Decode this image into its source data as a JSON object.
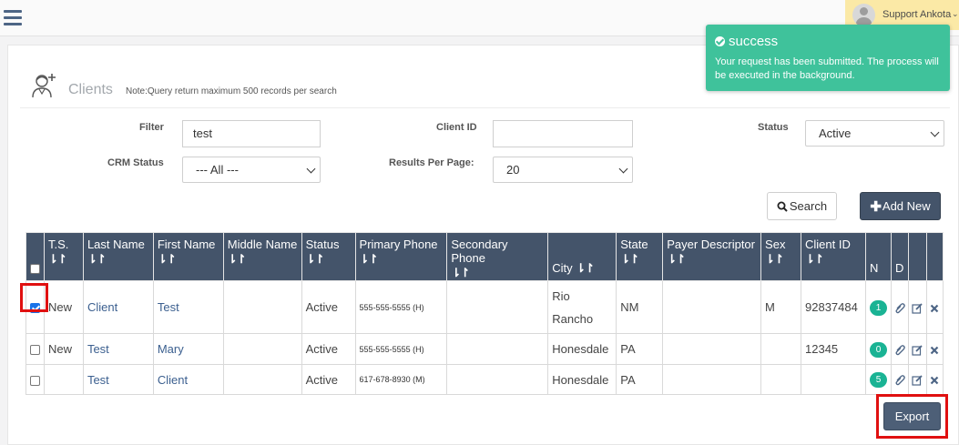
{
  "topbar": {
    "user_name": "Support Ankota",
    "caret": "⌄"
  },
  "page": {
    "title": "Clients",
    "note": "Note:Query return maximum 500 records per search"
  },
  "filters": {
    "filter_label": "Filter",
    "filter_value": "test",
    "client_id_label": "Client ID",
    "client_id_value": "",
    "status_label": "Status",
    "status_value": "Active",
    "crm_status_label": "CRM Status",
    "crm_status_value": "--- All ---",
    "results_per_page_label": "Results Per Page:",
    "results_per_page_value": "20"
  },
  "buttons": {
    "search": "Search",
    "add_new": "Add New",
    "export": "Export"
  },
  "table": {
    "headers": [
      "T.S.",
      "Last Name",
      "First Name",
      "Middle Name",
      "Status",
      "Primary Phone",
      "Secondary Phone",
      "City",
      "State",
      "Payer Descriptor",
      "Sex",
      "Client ID",
      "N",
      "D"
    ],
    "sort_glyph": "⇂↾",
    "rows": [
      {
        "checked": true,
        "ts": "New",
        "last": "Client",
        "first": "Test",
        "middle": "",
        "status": "Active",
        "primary_phone": "555-555-5555 (H)",
        "secondary_phone": "",
        "city_line1": "Rio",
        "city_line2": "Rancho",
        "state": "NM",
        "payer": "",
        "sex": "M",
        "client_id": "92837484",
        "notes": "1"
      },
      {
        "checked": false,
        "ts": "New",
        "last": "Test",
        "first": "Mary",
        "middle": "",
        "status": "Active",
        "primary_phone": "555-555-5555 (H)",
        "secondary_phone": "",
        "city_line1": "Honesdale",
        "city_line2": "",
        "state": "PA",
        "payer": "",
        "sex": "",
        "client_id": "12345",
        "notes": "0"
      },
      {
        "checked": false,
        "ts": "",
        "last": "Test",
        "first": "Client",
        "middle": "",
        "status": "Active",
        "primary_phone": "617-678-8930 (M)",
        "secondary_phone": "",
        "city_line1": "Honesdale",
        "city_line2": "",
        "state": "PA",
        "payer": "",
        "sex": "",
        "client_id": "",
        "notes": "5"
      }
    ]
  },
  "toast": {
    "title": "success",
    "message": "Your request has been submitted. The process will be executed in the background."
  },
  "colors": {
    "header_bg": "#44546a",
    "toast_bg": "#3fc29b",
    "badge": "#1ab394",
    "highlight": "#e01010",
    "link": "#3b5f8f"
  }
}
